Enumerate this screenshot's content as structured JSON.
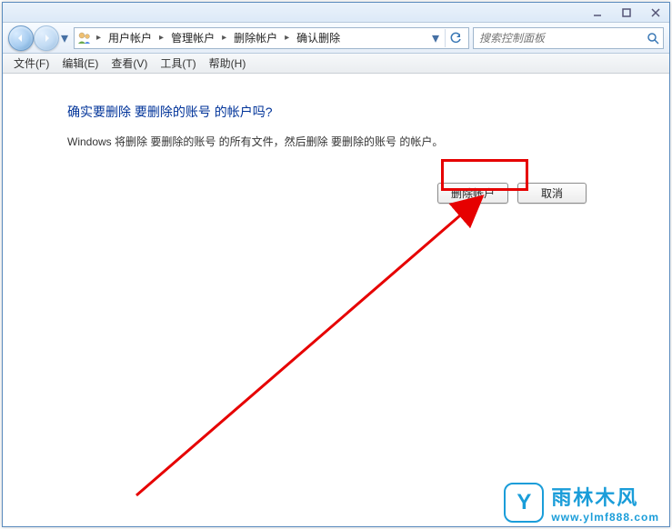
{
  "breadcrumb": {
    "items": [
      "用户帐户",
      "管理帐户",
      "删除帐户",
      "确认删除"
    ]
  },
  "search": {
    "placeholder": "搜索控制面板"
  },
  "menu": {
    "file": "文件(F)",
    "edit": "编辑(E)",
    "view": "查看(V)",
    "tools": "工具(T)",
    "help": "帮助(H)"
  },
  "page": {
    "heading": "确实要删除 要删除的账号 的帐户吗?",
    "body": "Windows 将删除 要删除的账号 的所有文件，然后删除 要删除的账号 的帐户。",
    "delete_btn": "删除帐户",
    "cancel_btn": "取消"
  },
  "watermark": {
    "badge_letter": "Y",
    "cn": "雨林木风",
    "en": "www.ylmf888.com"
  }
}
